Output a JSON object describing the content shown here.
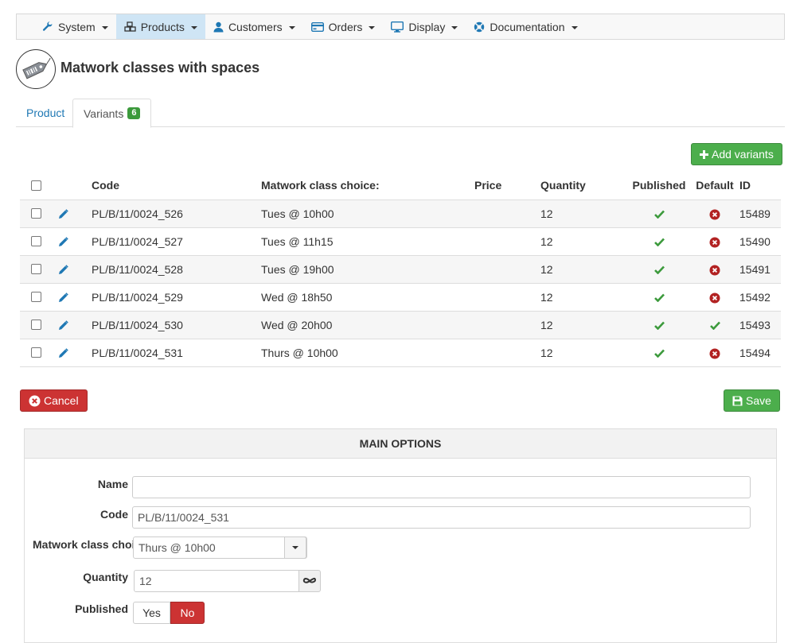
{
  "nav": {
    "items": [
      {
        "label": "System",
        "icon": "wrench-icon"
      },
      {
        "label": "Products",
        "icon": "cubes-icon"
      },
      {
        "label": "Customers",
        "icon": "user-icon"
      },
      {
        "label": "Orders",
        "icon": "credit-card-icon"
      },
      {
        "label": "Display",
        "icon": "monitor-icon"
      },
      {
        "label": "Documentation",
        "icon": "lifebuoy-icon"
      }
    ],
    "active": "Products"
  },
  "page": {
    "title": "Matwork classes with spaces",
    "logo_icon": "price-tag-icon"
  },
  "tabs": {
    "product": "Product",
    "variants": "Variants",
    "variants_count": "6"
  },
  "toolbar": {
    "add_variants": "Add variants",
    "cancel": "Cancel",
    "save": "Save"
  },
  "table": {
    "headers": {
      "code": "Code",
      "choice": "Matwork class choice:",
      "price": "Price",
      "quantity": "Quantity",
      "published": "Published",
      "default": "Default",
      "id": "ID"
    },
    "rows": [
      {
        "code": "PL/B/11/0024_526",
        "choice": "Tues @ 10h00",
        "price": "",
        "quantity": "12",
        "published": true,
        "default": false,
        "id": "15489"
      },
      {
        "code": "PL/B/11/0024_527",
        "choice": "Tues @ 11h15",
        "price": "",
        "quantity": "12",
        "published": true,
        "default": false,
        "id": "15490"
      },
      {
        "code": "PL/B/11/0024_528",
        "choice": "Tues @ 19h00",
        "price": "",
        "quantity": "12",
        "published": true,
        "default": false,
        "id": "15491"
      },
      {
        "code": "PL/B/11/0024_529",
        "choice": "Wed @ 18h50",
        "price": "",
        "quantity": "12",
        "published": true,
        "default": false,
        "id": "15492"
      },
      {
        "code": "PL/B/11/0024_530",
        "choice": "Wed @ 20h00",
        "price": "",
        "quantity": "12",
        "published": true,
        "default": true,
        "id": "15493"
      },
      {
        "code": "PL/B/11/0024_531",
        "choice": "Thurs @ 10h00",
        "price": "",
        "quantity": "12",
        "published": true,
        "default": false,
        "id": "15494"
      }
    ]
  },
  "main_options": {
    "heading": "MAIN OPTIONS",
    "name_label": "Name",
    "name_value": "",
    "code_label": "Code",
    "code_value": "PL/B/11/0024_531",
    "choice_label": "Matwork class choice:",
    "choice_value": "Thurs @ 10h00",
    "quantity_label": "Quantity",
    "quantity_value": "12",
    "published_label": "Published",
    "published_yes": "Yes",
    "published_no": "No"
  },
  "colors": {
    "accent_blue": "#1f78b4",
    "success_green": "#4cae4c",
    "danger_red": "#cc3333",
    "nav_active": "#cfe5f5"
  }
}
